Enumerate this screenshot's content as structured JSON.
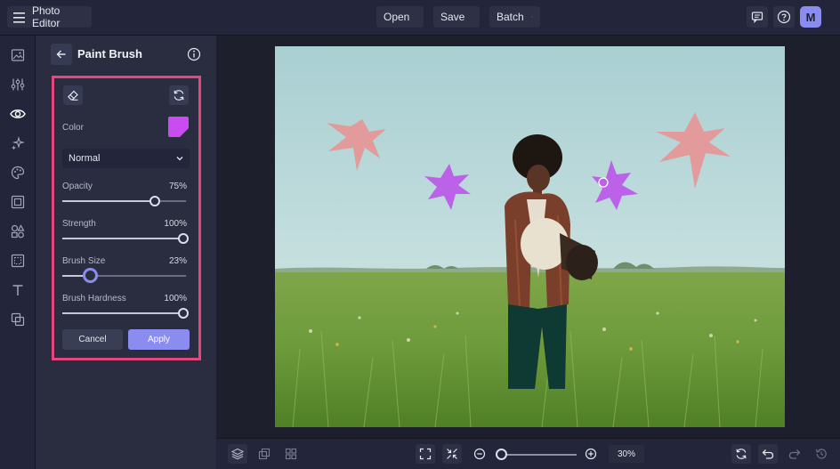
{
  "app": {
    "title": "Photo Editor"
  },
  "topbar": {
    "menus": [
      {
        "label": "Open"
      },
      {
        "label": "Save"
      },
      {
        "label": "Batch"
      }
    ],
    "avatar_initial": "M"
  },
  "panel": {
    "title": "Paint Brush",
    "color_label": "Color",
    "color_value": "#c84cf0",
    "blend_mode": "Normal",
    "sliders": [
      {
        "label": "Opacity",
        "value_text": "75%",
        "value": 0.75
      },
      {
        "label": "Strength",
        "value_text": "100%",
        "value": 1.0
      },
      {
        "label": "Brush Size",
        "value_text": "23%",
        "value": 0.23
      },
      {
        "label": "Brush Hardness",
        "value_text": "100%",
        "value": 1.0
      }
    ],
    "cancel_label": "Cancel",
    "apply_label": "Apply"
  },
  "zoom": {
    "value_text": "30%",
    "value": 0.0
  },
  "colors": {
    "accent": "#8a8cf0",
    "highlight_border": "#e8457c",
    "panel_bg": "#2a2d40"
  }
}
